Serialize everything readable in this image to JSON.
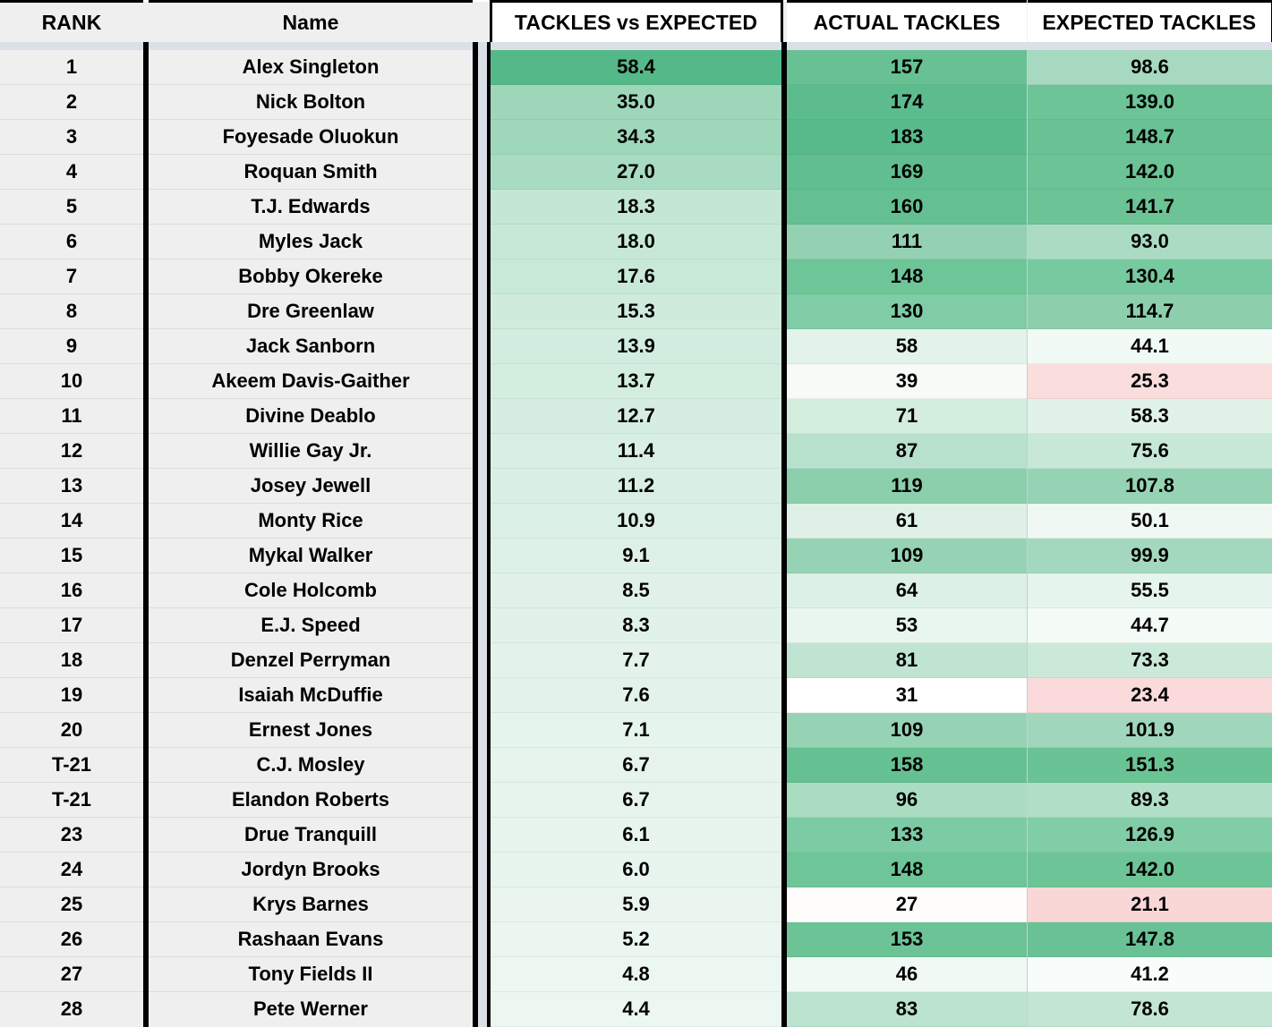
{
  "table": {
    "columns": [
      {
        "key": "rank",
        "label": "RANK"
      },
      {
        "key": "name",
        "label": "Name"
      },
      {
        "key": "tve",
        "label": "TACKLES vs EXPECTED"
      },
      {
        "key": "actual",
        "label": "ACTUAL TACKLES"
      },
      {
        "key": "expected",
        "label": "EXPECTED TACKLES"
      }
    ],
    "rows": [
      {
        "rank": "1",
        "name": "Alex Singleton",
        "tve": "58.4",
        "actual": "157",
        "expected": "98.6",
        "tve_color": "#55b889",
        "actual_color": "#67c193",
        "expected_color": "#a6d9bf"
      },
      {
        "rank": "2",
        "name": "Nick Bolton",
        "tve": "35.0",
        "actual": "174",
        "expected": "139.0",
        "tve_color": "#9ed6ba",
        "actual_color": "#5dbc8e",
        "expected_color": "#6cc497"
      },
      {
        "rank": "3",
        "name": "Foyesade Oluokun",
        "tve": "34.3",
        "actual": "183",
        "expected": "148.7",
        "tve_color": "#9fd7bb",
        "actual_color": "#59ba8b",
        "expected_color": "#68c294"
      },
      {
        "rank": "4",
        "name": "Roquan Smith",
        "tve": "27.0",
        "actual": "169",
        "expected": "142.0",
        "tve_color": "#a8dbc1",
        "actual_color": "#60be90",
        "expected_color": "#6bc396"
      },
      {
        "rank": "5",
        "name": "T.J. Edwards",
        "tve": "18.3",
        "actual": "160",
        "expected": "141.7",
        "tve_color": "#c4e6d5",
        "actual_color": "#64c092",
        "expected_color": "#6bc396"
      },
      {
        "rank": "6",
        "name": "Myles Jack",
        "tve": "18.0",
        "actual": "111",
        "expected": "93.0",
        "tve_color": "#c7e8d7",
        "actual_color": "#93d1b2",
        "expected_color": "#abdcc3"
      },
      {
        "rank": "7",
        "name": "Bobby Okereke",
        "tve": "17.6",
        "actual": "148",
        "expected": "130.4",
        "tve_color": "#c9e9d8",
        "actual_color": "#6ec598",
        "expected_color": "#77c99f"
      },
      {
        "rank": "8",
        "name": "Dre Greenlaw",
        "tve": "15.3",
        "actual": "130",
        "expected": "114.7",
        "tve_color": "#cfebdc",
        "actual_color": "#80cca6",
        "expected_color": "#8dcfad"
      },
      {
        "rank": "9",
        "name": "Jack Sanborn",
        "tve": "13.9",
        "actual": "58",
        "expected": "44.1",
        "tve_color": "#d2eddf",
        "actual_color": "#e2f3ea",
        "expected_color": "#f2faf5"
      },
      {
        "rank": "10",
        "name": "Akeem Davis-Gaither",
        "tve": "13.7",
        "actual": "39",
        "expected": "25.3",
        "tve_color": "#d3eddf",
        "actual_color": "#f6fbf8",
        "expected_color": "#fadddd"
      },
      {
        "rank": "11",
        "name": "Divine Deablo",
        "tve": "12.7",
        "actual": "71",
        "expected": "58.3",
        "tve_color": "#d5eee1",
        "actual_color": "#d3edde",
        "expected_color": "#e1f2e9"
      },
      {
        "rank": "12",
        "name": "Willie Gay Jr.",
        "tve": "11.4",
        "actual": "87",
        "expected": "75.6",
        "tve_color": "#d8efe3",
        "actual_color": "#b8e1cd",
        "expected_color": "#c7e8d7"
      },
      {
        "rank": "13",
        "name": "Josey Jewell",
        "tve": "11.2",
        "actual": "119",
        "expected": "107.8",
        "tve_color": "#d9efe3",
        "actual_color": "#8ccfac",
        "expected_color": "#96d3b4"
      },
      {
        "rank": "14",
        "name": "Monty Rice",
        "tve": "10.9",
        "actual": "61",
        "expected": "50.1",
        "tve_color": "#daf0e4",
        "actual_color": "#dff1e7",
        "expected_color": "#eff8f3"
      },
      {
        "rank": "15",
        "name": "Mykal Walker",
        "tve": "9.1",
        "actual": "109",
        "expected": "99.9",
        "tve_color": "#def1e7",
        "actual_color": "#96d3b4",
        "expected_color": "#a3d8be"
      },
      {
        "rank": "16",
        "name": "Cole Holcomb",
        "tve": "8.5",
        "actual": "64",
        "expected": "55.5",
        "tve_color": "#e0f2e8",
        "actual_color": "#dcf0e5",
        "expected_color": "#e5f4ec"
      },
      {
        "rank": "17",
        "name": "E.J. Speed",
        "tve": "8.3",
        "actual": "53",
        "expected": "44.7",
        "tve_color": "#e1f2e9",
        "actual_color": "#e8f6ee",
        "expected_color": "#f4fbf7"
      },
      {
        "rank": "18",
        "name": "Denzel Perryman",
        "tve": "7.7",
        "actual": "81",
        "expected": "73.3",
        "tve_color": "#e3f3ea",
        "actual_color": "#c0e4d2",
        "expected_color": "#cbe9d9"
      },
      {
        "rank": "19",
        "name": "Isaiah McDuffie",
        "tve": "7.6",
        "actual": "31",
        "expected": "23.4",
        "tve_color": "#e3f3ea",
        "actual_color": "#ffffff",
        "expected_color": "#fadada"
      },
      {
        "rank": "20",
        "name": "Ernest Jones",
        "tve": "7.1",
        "actual": "109",
        "expected": "101.9",
        "tve_color": "#e5f4ec",
        "actual_color": "#96d3b4",
        "expected_color": "#a0d7bc"
      },
      {
        "rank": "T-21",
        "name": "C.J. Mosley",
        "tve": "6.7",
        "actual": "158",
        "expected": "151.3",
        "tve_color": "#e6f4ec",
        "actual_color": "#66c192",
        "expected_color": "#6ac395"
      },
      {
        "rank": "T-21",
        "name": "Elandon Roberts",
        "tve": "6.7",
        "actual": "96",
        "expected": "89.3",
        "tve_color": "#e6f4ec",
        "actual_color": "#aadcc2",
        "expected_color": "#b1dfc7"
      },
      {
        "rank": "23",
        "name": "Drue Tranquill",
        "tve": "6.1",
        "actual": "133",
        "expected": "126.9",
        "tve_color": "#e8f5ee",
        "actual_color": "#7dcba4",
        "expected_color": "#81cda7"
      },
      {
        "rank": "24",
        "name": "Jordyn Brooks",
        "tve": "6.0",
        "actual": "148",
        "expected": "142.0",
        "tve_color": "#e8f5ee",
        "actual_color": "#6ec598",
        "expected_color": "#6dc497"
      },
      {
        "rank": "25",
        "name": "Krys Barnes",
        "tve": "5.9",
        "actual": "27",
        "expected": "21.1",
        "tve_color": "#e9f5ee",
        "actual_color": "#fffcfc",
        "expected_color": "#f9d7d7"
      },
      {
        "rank": "26",
        "name": "Rashaan Evans",
        "tve": "5.2",
        "actual": "153",
        "expected": "147.8",
        "tve_color": "#ebf6f0",
        "actual_color": "#6bc396",
        "expected_color": "#69c295"
      },
      {
        "rank": "27",
        "name": "Tony Fields II",
        "tve": "4.8",
        "actual": "46",
        "expected": "41.2",
        "tve_color": "#ecf7f1",
        "actual_color": "#f0f9f4",
        "expected_color": "#f8fcfa"
      },
      {
        "rank": "28",
        "name": "Pete Werner",
        "tve": "4.4",
        "actual": "83",
        "expected": "78.6",
        "tve_color": "#edf7f1",
        "actual_color": "#bce3d0",
        "expected_color": "#c3e6d4"
      }
    ]
  },
  "chart_data": {
    "type": "table",
    "title": "TACKLES vs EXPECTED",
    "columns": [
      "RANK",
      "Name",
      "TACKLES vs EXPECTED",
      "ACTUAL TACKLES",
      "EXPECTED TACKLES"
    ],
    "rows": [
      [
        "1",
        "Alex Singleton",
        58.4,
        157,
        98.6
      ],
      [
        "2",
        "Nick Bolton",
        35.0,
        174,
        139.0
      ],
      [
        "3",
        "Foyesade Oluokun",
        34.3,
        183,
        148.7
      ],
      [
        "4",
        "Roquan Smith",
        27.0,
        169,
        142.0
      ],
      [
        "5",
        "T.J. Edwards",
        18.3,
        160,
        141.7
      ],
      [
        "6",
        "Myles Jack",
        18.0,
        111,
        93.0
      ],
      [
        "7",
        "Bobby Okereke",
        17.6,
        148,
        130.4
      ],
      [
        "8",
        "Dre Greenlaw",
        15.3,
        130,
        114.7
      ],
      [
        "9",
        "Jack Sanborn",
        13.9,
        58,
        44.1
      ],
      [
        "10",
        "Akeem Davis-Gaither",
        13.7,
        39,
        25.3
      ],
      [
        "11",
        "Divine Deablo",
        12.7,
        71,
        58.3
      ],
      [
        "12",
        "Willie Gay Jr.",
        11.4,
        87,
        75.6
      ],
      [
        "13",
        "Josey Jewell",
        11.2,
        119,
        107.8
      ],
      [
        "14",
        "Monty Rice",
        10.9,
        61,
        50.1
      ],
      [
        "15",
        "Mykal Walker",
        9.1,
        109,
        99.9
      ],
      [
        "16",
        "Cole Holcomb",
        8.5,
        64,
        55.5
      ],
      [
        "17",
        "E.J. Speed",
        8.3,
        53,
        44.7
      ],
      [
        "18",
        "Denzel Perryman",
        7.7,
        81,
        73.3
      ],
      [
        "19",
        "Isaiah McDuffie",
        7.6,
        31,
        23.4
      ],
      [
        "20",
        "Ernest Jones",
        7.1,
        109,
        101.9
      ],
      [
        "T-21",
        "C.J. Mosley",
        6.7,
        158,
        151.3
      ],
      [
        "T-21",
        "Elandon Roberts",
        6.7,
        96,
        89.3
      ],
      [
        "23",
        "Drue Tranquill",
        6.1,
        133,
        126.9
      ],
      [
        "24",
        "Jordyn Brooks",
        6.0,
        148,
        142.0
      ],
      [
        "25",
        "Krys Barnes",
        5.9,
        27,
        21.1
      ],
      [
        "26",
        "Rashaan Evans",
        5.2,
        153,
        147.8
      ],
      [
        "27",
        "Tony Fields II",
        4.8,
        46,
        41.2
      ],
      [
        "28",
        "Pete Werner",
        4.4,
        83,
        78.6
      ]
    ],
    "heatmap": {
      "high_color": "#55b889",
      "low_color": "#ffffff",
      "negative_color": "#fadddd"
    }
  }
}
